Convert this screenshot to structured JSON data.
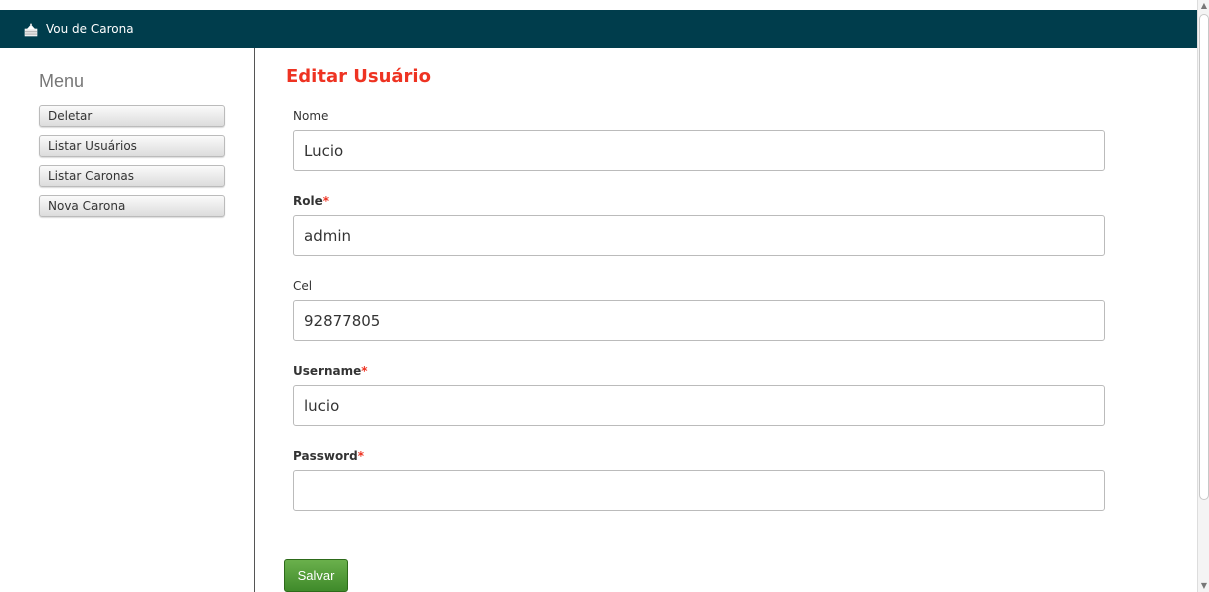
{
  "navbar": {
    "brand": "Vou de Carona",
    "brand_icon": "cake-icon",
    "color": "#003d4c"
  },
  "sidebar": {
    "title": "Menu",
    "items": [
      {
        "label": "Deletar"
      },
      {
        "label": "Listar Usuários"
      },
      {
        "label": "Listar Caronas"
      },
      {
        "label": "Nova Carona"
      }
    ]
  },
  "form": {
    "title": "Editar Usuário",
    "fields": {
      "nome": {
        "label": "Nome",
        "value": "Lucio"
      },
      "role": {
        "label": "Role",
        "required_mark": "*",
        "value": "admin"
      },
      "cel": {
        "label": "Cel",
        "value": "92877805"
      },
      "username": {
        "label": "Username",
        "required_mark": "*",
        "value": "lucio"
      },
      "password": {
        "label": "Password",
        "required_mark": "*",
        "value": ""
      }
    },
    "submit_label": "Salvar"
  },
  "colors": {
    "title": "#ee3322",
    "submit": "#4f9a34"
  }
}
